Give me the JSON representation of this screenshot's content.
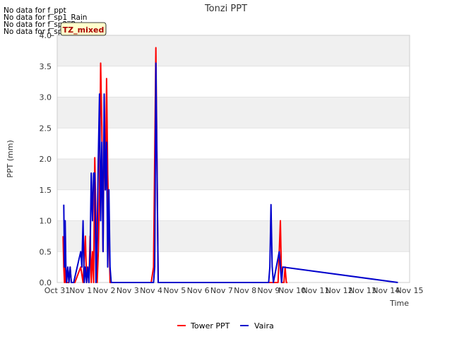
{
  "no_data_messages": [
    "No data for f_ppt",
    "No data for f_sp1_Rain",
    "No data for f_sp2_Rain",
    "No data for f_sp3_Rain"
  ],
  "badge": "TZ_mixed",
  "colors": {
    "tower": "#ff0000",
    "vaira": "#0000cc",
    "band": "#f0f0f0",
    "grid": "#dcdcdc",
    "badge_bg": "#ffffcc",
    "badge_text": "#aa0000"
  },
  "chart_data": {
    "type": "line",
    "title": "Tonzi PPT",
    "xlabel": "Time",
    "ylabel": "PPT (mm)",
    "xlim": [
      0,
      15
    ],
    "ylim": [
      0,
      4.0
    ],
    "xtick_labels": [
      "Oct 31",
      "Nov 1",
      "Nov 2",
      "Nov 3",
      "Nov 4",
      "Nov 5",
      "Nov 6",
      "Nov 7",
      "Nov 8",
      "Nov 9",
      "Nov 10",
      "Nov 11",
      "Nov 12",
      "Nov 13",
      "Nov 14",
      "Nov 15"
    ],
    "yticks": [
      0.0,
      0.5,
      1.0,
      1.5,
      2.0,
      2.5,
      3.0,
      3.5,
      4.0
    ],
    "ytick_labels": [
      "0.0",
      "0.5",
      "1.0",
      "1.5",
      "2.0",
      "2.5",
      "3.0",
      "3.5",
      "4.0"
    ],
    "legend_position": "bottom",
    "series": [
      {
        "name": "Tower PPT",
        "color": "#ff0000",
        "x": [
          0.25,
          0.28,
          0.31,
          0.34,
          0.37,
          0.4,
          0.45,
          0.5,
          0.55,
          0.6,
          0.65,
          0.7,
          0.75,
          1.0,
          1.1,
          1.2,
          1.25,
          1.3,
          1.35,
          1.4,
          1.45,
          1.5,
          1.55,
          1.6,
          1.65,
          1.7,
          1.75,
          1.8,
          1.85,
          1.9,
          1.95,
          2.0,
          2.05,
          2.1,
          2.15,
          2.2,
          2.25,
          2.3,
          2.35,
          2.4,
          2.45,
          2.5,
          2.55,
          2.6,
          2.65,
          2.7,
          2.75,
          2.8,
          2.85,
          2.9,
          2.95,
          3.0,
          3.05,
          3.1,
          3.15,
          3.2,
          3.25,
          3.3,
          3.35,
          3.4,
          3.45,
          3.5,
          3.55,
          3.6,
          3.65,
          3.7,
          3.75,
          3.8,
          3.85,
          3.9,
          3.95,
          4.0,
          4.1,
          4.2,
          4.3,
          4.4,
          4.5,
          4.6,
          9.2,
          9.3,
          9.4,
          9.45,
          9.5,
          9.55,
          9.6,
          9.65,
          9.7,
          9.75,
          9.8
        ],
        "y": [
          0.75,
          0.25,
          0.0,
          0.25,
          0.0,
          0.0,
          0.0,
          0.0,
          0.25,
          0.0,
          0.0,
          0.0,
          0.0,
          0.25,
          0.0,
          0.75,
          0.0,
          0.25,
          0.0,
          0.75,
          0.0,
          0.5,
          0.0,
          2.02,
          1.0,
          0.0,
          0.5,
          1.5,
          3.55,
          2.52,
          0.5,
          2.52,
          1.5,
          3.3,
          1.75,
          1.0,
          0.0,
          0.0,
          0.0,
          0.0,
          0.0,
          0.0,
          0.0,
          0.0,
          0.0,
          0.0,
          0.0,
          0.0,
          0.0,
          0.0,
          0.0,
          0.0,
          0.0,
          0.0,
          0.0,
          0.0,
          0.0,
          0.0,
          0.0,
          0.0,
          0.0,
          0.0,
          0.0,
          0.0,
          0.0,
          0.0,
          0.0,
          0.0,
          0.0,
          0.0,
          0.0,
          0.0,
          0.25,
          3.8,
          0.0,
          0.0,
          0.0,
          0.0,
          0.0,
          0.0,
          0.0,
          0.5,
          1.0,
          0.0,
          0.0,
          0.0,
          0.25,
          0.0,
          0.0
        ]
      },
      {
        "name": "Vaira",
        "color": "#0000cc",
        "x": [
          0.28,
          0.31,
          0.34,
          0.37,
          0.4,
          0.45,
          0.5,
          0.55,
          0.6,
          0.65,
          0.7,
          1.0,
          1.05,
          1.1,
          1.15,
          1.2,
          1.25,
          1.3,
          1.35,
          1.4,
          1.45,
          1.5,
          1.55,
          1.6,
          1.65,
          1.7,
          1.75,
          1.8,
          1.85,
          1.9,
          1.95,
          2.0,
          2.05,
          2.1,
          2.15,
          2.2,
          2.25,
          2.3,
          4.1,
          4.15,
          4.2,
          4.3,
          9.0,
          9.05,
          9.1,
          9.15,
          9.2,
          9.45,
          9.5,
          9.55,
          9.6,
          14.5
        ],
        "y": [
          1.26,
          0.25,
          1.0,
          0.25,
          0.0,
          0.25,
          0.0,
          0.25,
          0.0,
          0.0,
          0.0,
          0.5,
          0.25,
          1.0,
          0.0,
          0.25,
          0.0,
          0.25,
          0.0,
          0.5,
          1.77,
          1.0,
          1.77,
          1.77,
          0.0,
          0.75,
          2.02,
          3.05,
          1.0,
          2.27,
          0.5,
          3.05,
          1.5,
          2.27,
          0.25,
          1.5,
          0.25,
          0.0,
          0.0,
          0.25,
          3.55,
          0.0,
          0.0,
          0.25,
          1.26,
          0.25,
          0.0,
          0.5,
          0.25,
          0.0,
          0.25,
          0.0
        ]
      }
    ]
  }
}
